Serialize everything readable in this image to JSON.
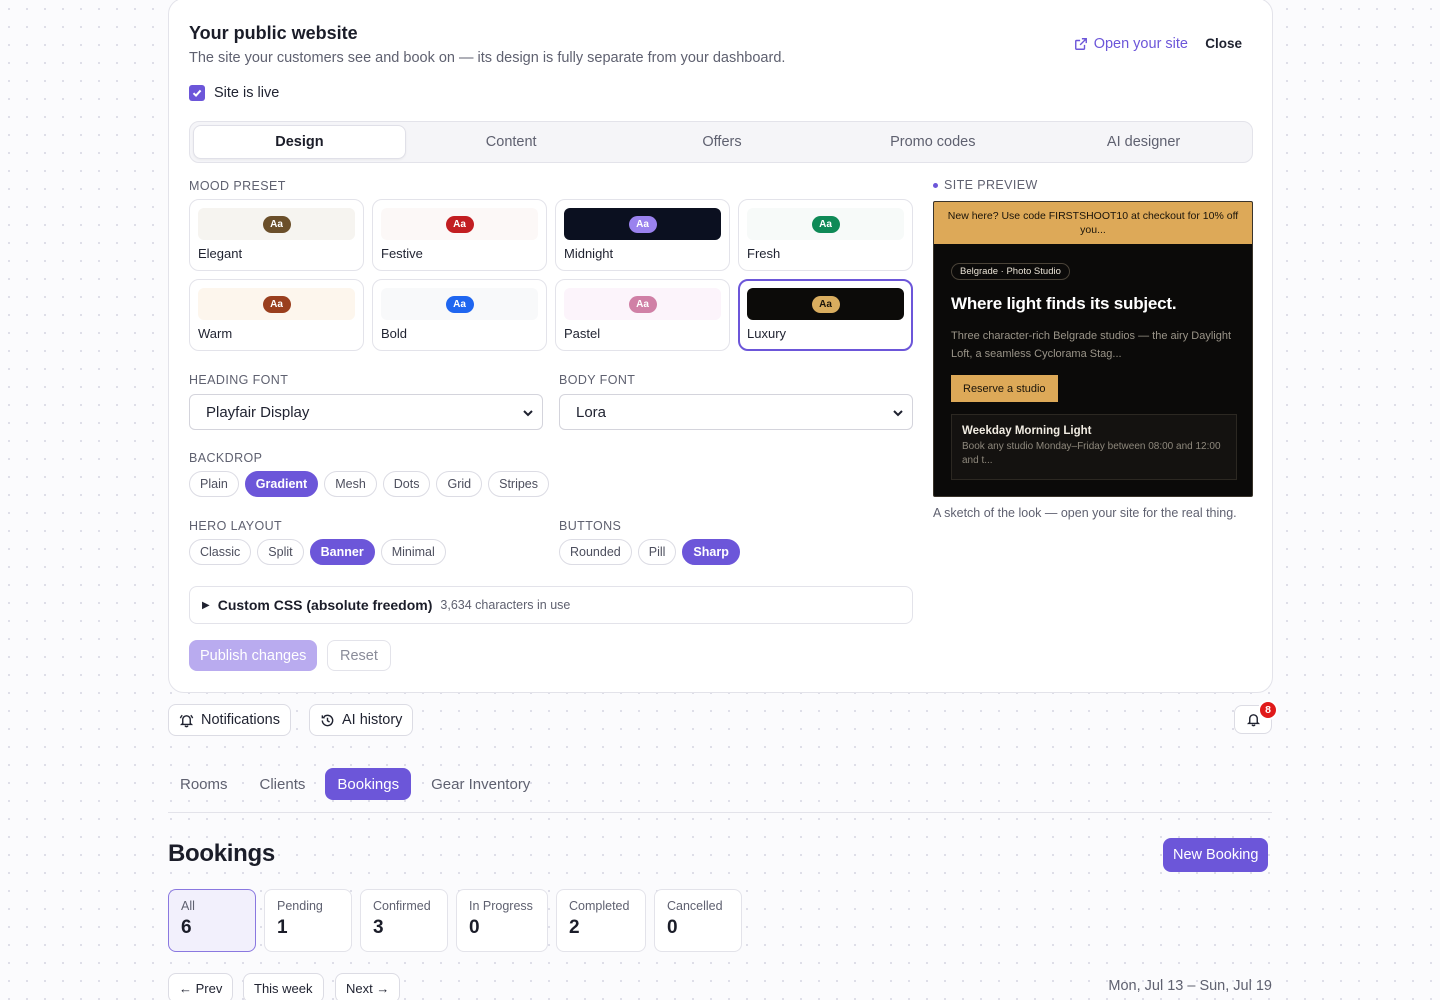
{
  "panel": {
    "title": "Your public website",
    "subtitle": "The site your customers see and book on — its design is fully separate from your dashboard.",
    "open_site": "Open your site",
    "close": "Close",
    "site_live": "Site is live"
  },
  "tabs": [
    "Design",
    "Content",
    "Offers",
    "Promo codes",
    "AI designer"
  ],
  "mood_preset": {
    "label": "MOOD PRESET",
    "presets": [
      {
        "name": "Elegant",
        "swatch": "#f6f4f0",
        "chip": "#6b4f2a"
      },
      {
        "name": "Festive",
        "swatch": "#fcf8f7",
        "chip": "#c21e22"
      },
      {
        "name": "Midnight",
        "swatch": "#0b1020",
        "chip": "#9a82ee"
      },
      {
        "name": "Fresh",
        "swatch": "#f7faf9",
        "chip": "#0f8a57"
      },
      {
        "name": "Warm",
        "swatch": "#fdf6ed",
        "chip": "#9a3f1e"
      },
      {
        "name": "Bold",
        "swatch": "#f8f9fa",
        "chip": "#1f66f0"
      },
      {
        "name": "Pastel",
        "swatch": "#fcf4fb",
        "chip": "#d080a6"
      },
      {
        "name": "Luxury",
        "swatch": "#0c0b09",
        "chip": "#d9ad5f"
      }
    ],
    "chip_text": "Aa"
  },
  "heading_font": {
    "label": "HEADING FONT",
    "value": "Playfair Display"
  },
  "body_font": {
    "label": "BODY FONT",
    "value": "Lora"
  },
  "backdrop": {
    "label": "BACKDROP",
    "options": [
      "Plain",
      "Gradient",
      "Mesh",
      "Dots",
      "Grid",
      "Stripes"
    ],
    "selected": "Gradient"
  },
  "hero_layout": {
    "label": "HERO LAYOUT",
    "options": [
      "Classic",
      "Split",
      "Banner",
      "Minimal"
    ],
    "selected": "Banner"
  },
  "buttons": {
    "label": "BUTTONS",
    "options": [
      "Rounded",
      "Pill",
      "Sharp"
    ],
    "selected": "Sharp"
  },
  "custom_css": {
    "title": "Custom CSS (absolute freedom)",
    "count": "3,634 characters in use"
  },
  "actions": {
    "publish": "Publish changes",
    "reset": "Reset"
  },
  "preview": {
    "label": "SITE PREVIEW",
    "promo": "New here? Use code FIRSTSHOOT10 at checkout for 10% off you...",
    "badge": "Belgrade · Photo Studio",
    "title": "Where light finds its subject.",
    "description": "Three character-rich Belgrade studios — the airy Daylight Loft, a seamless Cyclorama Stag...",
    "cta": "Reserve a studio",
    "card_title": "Weekday Morning Light",
    "card_desc": "Book any studio Monday–Friday between 08:00 and 12:00 and t...",
    "note": "A sketch of the look — open your site for the real thing."
  },
  "toolbar": {
    "notifications": "Notifications",
    "ai_history": "AI history",
    "badge_count": "8"
  },
  "nav": {
    "items": [
      "Rooms",
      "Clients",
      "Bookings",
      "Gear Inventory"
    ],
    "active": "Bookings"
  },
  "bookings": {
    "title": "Bookings",
    "new_button": "New Booking",
    "stats": [
      {
        "label": "All",
        "value": "6"
      },
      {
        "label": "Pending",
        "value": "1"
      },
      {
        "label": "Confirmed",
        "value": "3"
      },
      {
        "label": "In Progress",
        "value": "0"
      },
      {
        "label": "Completed",
        "value": "2"
      },
      {
        "label": "Cancelled",
        "value": "0"
      }
    ],
    "prev": "← Prev",
    "this_week": "This week",
    "next": "Next →",
    "range": "Mon, Jul 13 – Sun, Jul 19"
  },
  "colors": {
    "accent": "#6c56d9",
    "badge": "#e01a1a",
    "preview_gold": "#dda958"
  }
}
